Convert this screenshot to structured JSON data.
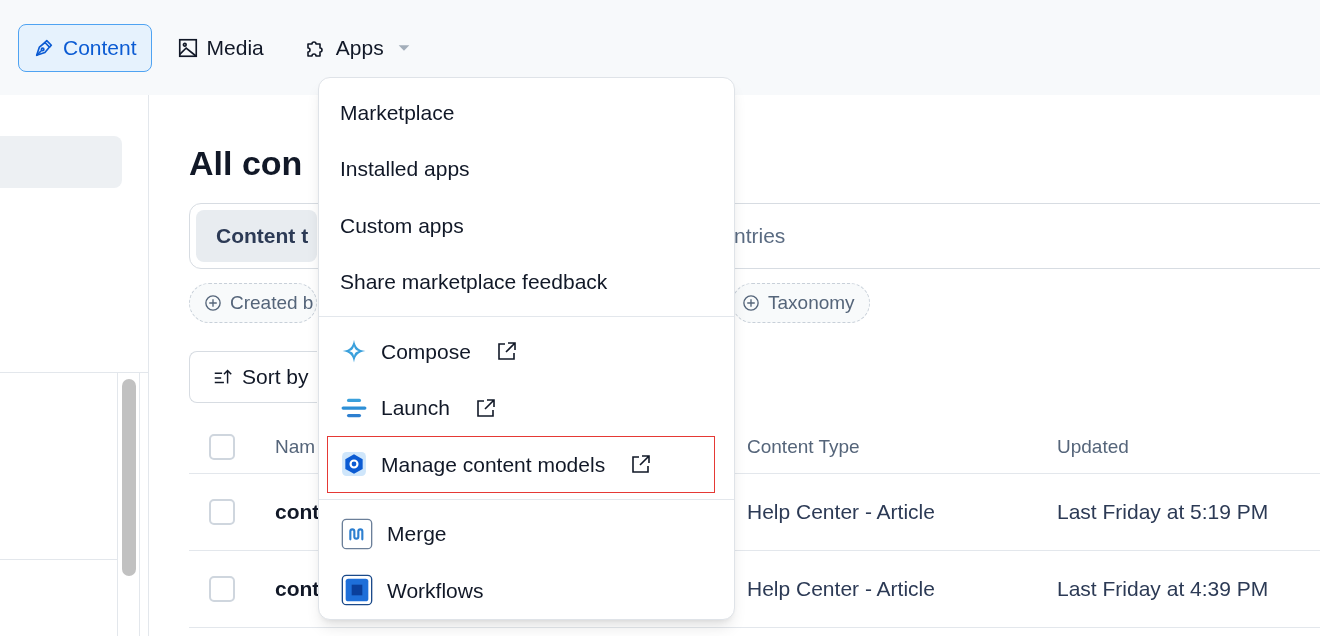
{
  "nav": [
    {
      "label": "Content",
      "selected": true
    },
    {
      "label": "Media",
      "selected": false
    },
    {
      "label": "Apps",
      "selected": false,
      "expanded": true
    }
  ],
  "apps_menu": {
    "sections": [
      {
        "items": [
          {
            "kind": "link",
            "label": "Marketplace"
          },
          {
            "kind": "link",
            "label": "Installed apps"
          },
          {
            "kind": "link",
            "label": "Custom apps"
          },
          {
            "kind": "link",
            "label": "Share marketplace feedback"
          }
        ]
      },
      {
        "items": [
          {
            "kind": "app",
            "label": "Compose",
            "external": true,
            "highlighted": false
          },
          {
            "kind": "app",
            "label": "Launch",
            "external": true,
            "highlighted": false
          },
          {
            "kind": "app",
            "label": "Manage content models",
            "external": true,
            "highlighted": true
          }
        ]
      },
      {
        "items": [
          {
            "kind": "tile",
            "label": "Merge",
            "external": false,
            "highlighted": false
          },
          {
            "kind": "tile",
            "label": "Workflows",
            "external": false,
            "highlighted": false
          }
        ]
      }
    ]
  },
  "page": {
    "title": "All con",
    "tabs": [
      {
        "label": "Content t",
        "selected": true
      },
      {
        "label": "ntries",
        "selected": false
      }
    ],
    "filters": [
      "Created b",
      "Taxonomy"
    ],
    "sort_button": "Sort by",
    "table": {
      "all_checked": false,
      "columns": [
        "Nam",
        "Content Type",
        "Updated"
      ],
      "rows": [
        {
          "checked": false,
          "cells": [
            "cont",
            "Help Center - Article",
            "Last Friday at 5:19 PM"
          ]
        },
        {
          "checked": false,
          "cells": [
            "cont",
            "Help Center - Article",
            "Last Friday at 4:39 PM"
          ]
        }
      ]
    }
  }
}
